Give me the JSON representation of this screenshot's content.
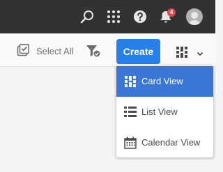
{
  "header": {
    "search_icon": "search-icon",
    "apps_icon": "grid-apps-icon",
    "help_icon": "help-icon",
    "notifications_icon": "bell-icon",
    "notification_count": "4",
    "avatar_icon": "user-avatar"
  },
  "toolbar": {
    "select_all_label": "Select All",
    "filter_icon": "filter-icon",
    "create_label": "Create",
    "view_switcher_icon": "card-view-icon"
  },
  "view_menu": {
    "items": [
      {
        "label": "Card View",
        "icon": "card-view-icon",
        "selected": true
      },
      {
        "label": "List View",
        "icon": "list-view-icon",
        "selected": false
      },
      {
        "label": "Calendar View",
        "icon": "calendar-view-icon",
        "selected": false
      }
    ]
  },
  "colors": {
    "header_bg": "#323232",
    "accent": "#2680eb",
    "selected_item": "#3a77d6",
    "badge": "#e34850"
  }
}
